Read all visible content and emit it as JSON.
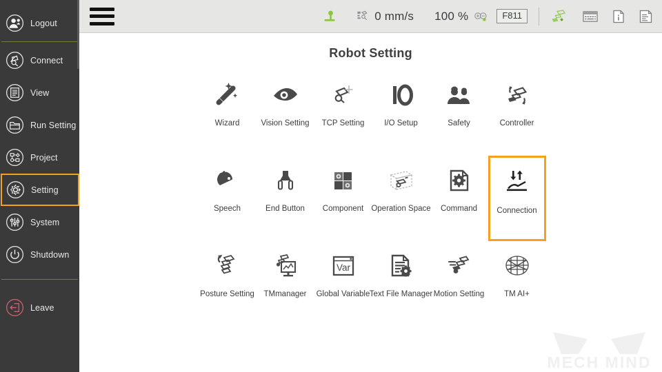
{
  "sidebar": {
    "items": [
      {
        "id": "logout",
        "label": "Logout",
        "icon": "user-logout-icon",
        "selected": false,
        "sep_after": true
      },
      {
        "id": "connect",
        "label": "Connect",
        "icon": "connect-icon",
        "selected": false,
        "sep_after": false
      },
      {
        "id": "view",
        "label": "View",
        "icon": "view-icon",
        "selected": false,
        "sep_after": false
      },
      {
        "id": "run-setting",
        "label": "Run Setting",
        "icon": "folder-icon",
        "selected": false,
        "sep_after": false
      },
      {
        "id": "project",
        "label": "Project",
        "icon": "project-icon",
        "selected": false,
        "sep_after": false
      },
      {
        "id": "setting",
        "label": "Setting",
        "icon": "gear-icon",
        "selected": true,
        "sep_after": false
      },
      {
        "id": "system",
        "label": "System",
        "icon": "sliders-icon",
        "selected": false,
        "sep_after": false
      },
      {
        "id": "shutdown",
        "label": "Shutdown",
        "icon": "power-icon",
        "selected": false,
        "sep_after": true
      },
      {
        "id": "leave",
        "label": "Leave",
        "icon": "exit-icon",
        "selected": false,
        "sep_after": false
      }
    ],
    "selected_color": "#f5a01e",
    "background_color": "#3a3a3a",
    "separator_color": "#6f7d3f",
    "leave_icon_color": "#c4616b"
  },
  "toolbar": {
    "menu_icon": "hamburger-menu-icon",
    "robot_status_icon": "robot-base-icon",
    "robot_status_color": "#7ab929",
    "speed_icon": "speed-icon",
    "speed_value": "0 mm/s",
    "percent_value": "100 %",
    "zoom_icon": "zoom-in-out-icon",
    "project_code": "F811",
    "network_icon": "network-nodes-icon",
    "network_icon_color": "#8cc63f",
    "keyboard_icon": "keyboard-icon",
    "info_icon": "info-icon",
    "log_icon": "log-document-icon"
  },
  "main": {
    "title": "Robot Setting",
    "tiles": [
      {
        "id": "wizard",
        "label": "Wizard",
        "icon": "magic-wand-icon",
        "selected": false
      },
      {
        "id": "vision-setting",
        "label": "Vision Setting",
        "icon": "eye-icon",
        "selected": false
      },
      {
        "id": "tcp-setting",
        "label": "TCP Setting",
        "icon": "tcp-robot-arm-icon",
        "selected": false
      },
      {
        "id": "io-setup",
        "label": "I/O Setup",
        "icon": "io-text-icon",
        "selected": false
      },
      {
        "id": "safety",
        "label": "Safety",
        "icon": "two-workers-icon",
        "selected": false
      },
      {
        "id": "controller",
        "label": "Controller",
        "icon": "controller-icon",
        "selected": false
      },
      {
        "id": "speech",
        "label": "Speech",
        "icon": "speech-icon",
        "selected": false
      },
      {
        "id": "end-button",
        "label": "End Button",
        "icon": "end-effector-icon",
        "selected": false
      },
      {
        "id": "component",
        "label": "Component",
        "icon": "puzzle-gears-icon",
        "selected": false
      },
      {
        "id": "operation-space",
        "label": "Operation Space",
        "icon": "space-cube-icon",
        "selected": false
      },
      {
        "id": "command",
        "label": "Command",
        "icon": "gear-document-icon",
        "selected": false
      },
      {
        "id": "connection",
        "label": "Connection",
        "icon": "connection-arrows-icon",
        "selected": true
      },
      {
        "id": "posture-setting",
        "label": "Posture Setting",
        "icon": "posture-arm-icon",
        "selected": false
      },
      {
        "id": "tmmanager",
        "label": "TMmanager",
        "icon": "monitor-chart-icon",
        "selected": false
      },
      {
        "id": "global-variable",
        "label": "Global Variable",
        "icon": "var-window-icon",
        "selected": false
      },
      {
        "id": "text-file-manager",
        "label": "Text File Manager",
        "icon": "file-gear-icon",
        "selected": false
      },
      {
        "id": "motion-setting",
        "label": "Motion Setting",
        "icon": "motion-arm-icon",
        "selected": false
      },
      {
        "id": "tm-ai-plus",
        "label": "TM AI+",
        "icon": "ai-brain-icon",
        "selected": false
      }
    ],
    "selected_color": "#f5a01e"
  },
  "watermark": {
    "text": "MECH MIND",
    "icon": "mech-mind-logo-icon",
    "color": "#f0f0f0"
  }
}
